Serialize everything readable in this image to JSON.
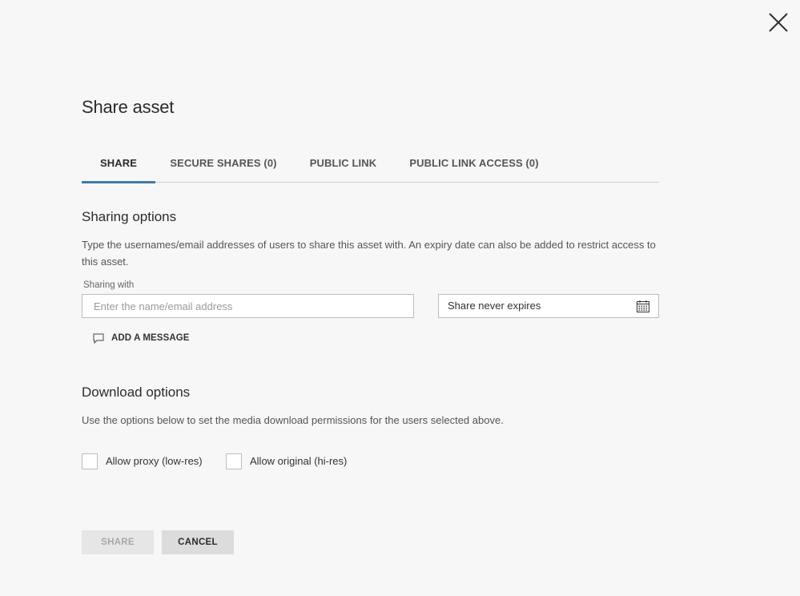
{
  "dialog": {
    "title": "Share asset"
  },
  "tabs": [
    {
      "label": "SHARE",
      "active": true
    },
    {
      "label": "SECURE SHARES (0)",
      "active": false
    },
    {
      "label": "PUBLIC LINK",
      "active": false
    },
    {
      "label": "PUBLIC LINK ACCESS (0)",
      "active": false
    }
  ],
  "sharing": {
    "heading": "Sharing options",
    "description": "Type the usernames/email addresses of users to share this asset with. An expiry date can also be added to restrict access to this asset.",
    "field_label": "Sharing with",
    "input_value": "",
    "input_placeholder": "Enter the name/email address",
    "expiry_value": "Share never expires",
    "add_message_label": "ADD A MESSAGE"
  },
  "download": {
    "heading": "Download options",
    "description": "Use the options below to set the media download permissions for the users selected above.",
    "options": [
      {
        "label": "Allow proxy (low-res)",
        "checked": false
      },
      {
        "label": "Allow original (hi-res)",
        "checked": false
      }
    ]
  },
  "actions": {
    "share_label": "SHARE",
    "cancel_label": "CANCEL"
  },
  "colors": {
    "accent": "#3f7ca8",
    "background": "#f7f7f7"
  },
  "icons": {
    "close": "close-icon",
    "calendar": "calendar-icon",
    "message": "speech-bubble-icon"
  }
}
